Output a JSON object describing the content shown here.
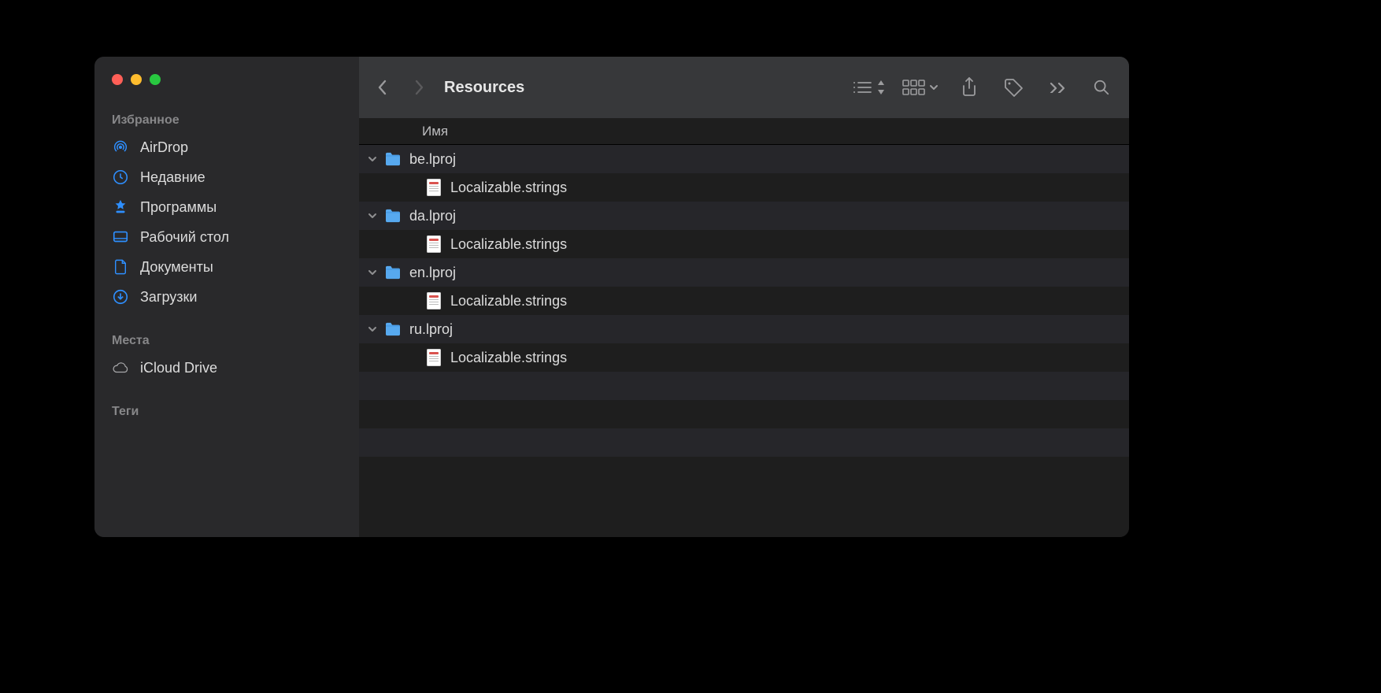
{
  "window_title": "Resources",
  "sidebar": {
    "sections": [
      {
        "label": "Избранное",
        "items": [
          {
            "icon": "airdrop",
            "label": "AirDrop"
          },
          {
            "icon": "clock",
            "label": "Недавние"
          },
          {
            "icon": "apps",
            "label": "Программы"
          },
          {
            "icon": "desktop",
            "label": "Рабочий стол"
          },
          {
            "icon": "doc",
            "label": "Документы"
          },
          {
            "icon": "download",
            "label": "Загрузки"
          }
        ]
      },
      {
        "label": "Места",
        "items": [
          {
            "icon": "cloud",
            "label": "iCloud Drive"
          }
        ]
      },
      {
        "label": "Теги",
        "items": []
      }
    ]
  },
  "columns": {
    "name": "Имя"
  },
  "files": [
    {
      "type": "folder",
      "name": "be.lproj",
      "depth": 0,
      "expanded": true
    },
    {
      "type": "file",
      "name": "Localizable.strings",
      "depth": 1
    },
    {
      "type": "folder",
      "name": "da.lproj",
      "depth": 0,
      "expanded": true
    },
    {
      "type": "file",
      "name": "Localizable.strings",
      "depth": 1
    },
    {
      "type": "folder",
      "name": "en.lproj",
      "depth": 0,
      "expanded": true
    },
    {
      "type": "file",
      "name": "Localizable.strings",
      "depth": 1
    },
    {
      "type": "folder",
      "name": "ru.lproj",
      "depth": 0,
      "expanded": true
    },
    {
      "type": "file",
      "name": "Localizable.strings",
      "depth": 1
    }
  ]
}
